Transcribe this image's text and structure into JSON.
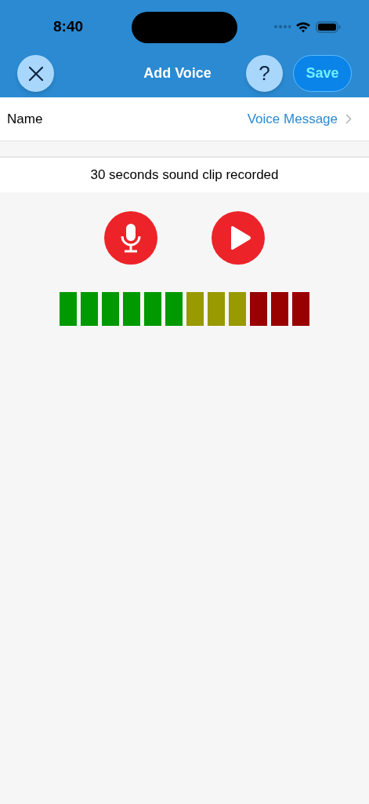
{
  "status_bar": {
    "time": "8:40"
  },
  "nav": {
    "title": "Add Voice",
    "save": "Save",
    "help": "?"
  },
  "name_row": {
    "label": "Name",
    "value": "Voice Message"
  },
  "status_text": "30 seconds sound clip recorded",
  "meter": {
    "segments": [
      {
        "color": "#009900"
      },
      {
        "color": "#009900"
      },
      {
        "color": "#009900"
      },
      {
        "color": "#009900"
      },
      {
        "color": "#009900"
      },
      {
        "color": "#009900"
      },
      {
        "color": "#999900"
      },
      {
        "color": "#999900"
      },
      {
        "color": "#999900"
      },
      {
        "color": "#990000"
      },
      {
        "color": "#990000"
      },
      {
        "color": "#990000"
      }
    ]
  }
}
